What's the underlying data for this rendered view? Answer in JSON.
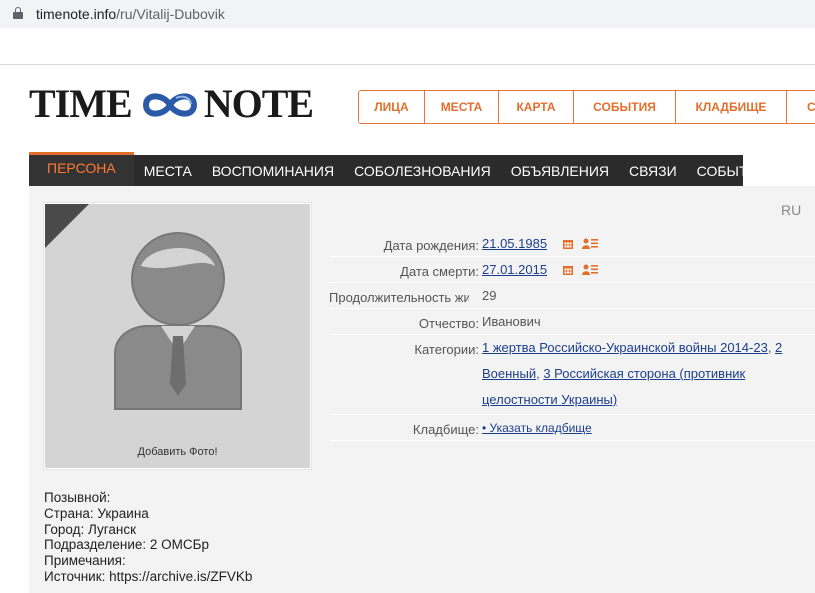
{
  "browser": {
    "url_host": "timenote.info",
    "url_path": "/ru/Vitalij-Dubovik"
  },
  "logo": {
    "left": "TIME",
    "right": "NOTE"
  },
  "topnav": [
    "ЛИЦА",
    "МЕСТА",
    "КАРТА",
    "СОБЫТИЯ",
    "КЛАДБИЩЕ",
    "С"
  ],
  "tabs": [
    "ПЕРСОНА",
    "МЕСТА",
    "ВОСПОМИНАНИЯ",
    "СОБОЛЕЗНОВАНИЯ",
    "ОБЪЯВЛЕНИЯ",
    "СВЯЗИ",
    "СОБЫТИЯ"
  ],
  "lang": "RU",
  "photo": {
    "caption": "Добавить Фото!"
  },
  "fields": {
    "birth_label": "Дата рождения:",
    "birth_value": "21.05.1985",
    "death_label": "Дата смерти:",
    "death_value": "27.01.2015",
    "duration_label": "Продолжительность жизни:",
    "duration_value": "29",
    "patronymic_label": "Отчество:",
    "patronymic_value": "Иванович",
    "categories_label": "Категории:",
    "categories": [
      "1 жертва Российско-Украинской войны 2014-23",
      "2 Военный",
      "3 Российская сторона (противник целостности Украины)"
    ],
    "cemetery_label": "Кладбище:",
    "cemetery_value": "• Указать кладбище"
  },
  "info": {
    "callsign": "Позывной:",
    "country": "Страна: Украина",
    "city": "Город: Луганск",
    "unit": "Подразделение: 2 ОМСБр",
    "notes": "Примечания:",
    "source": "Источник: https://archive.is/ZFVKb"
  },
  "colors": {
    "accent": "#e36f2c",
    "link": "#1b3f8c",
    "tabbar": "#2b2b2b"
  }
}
